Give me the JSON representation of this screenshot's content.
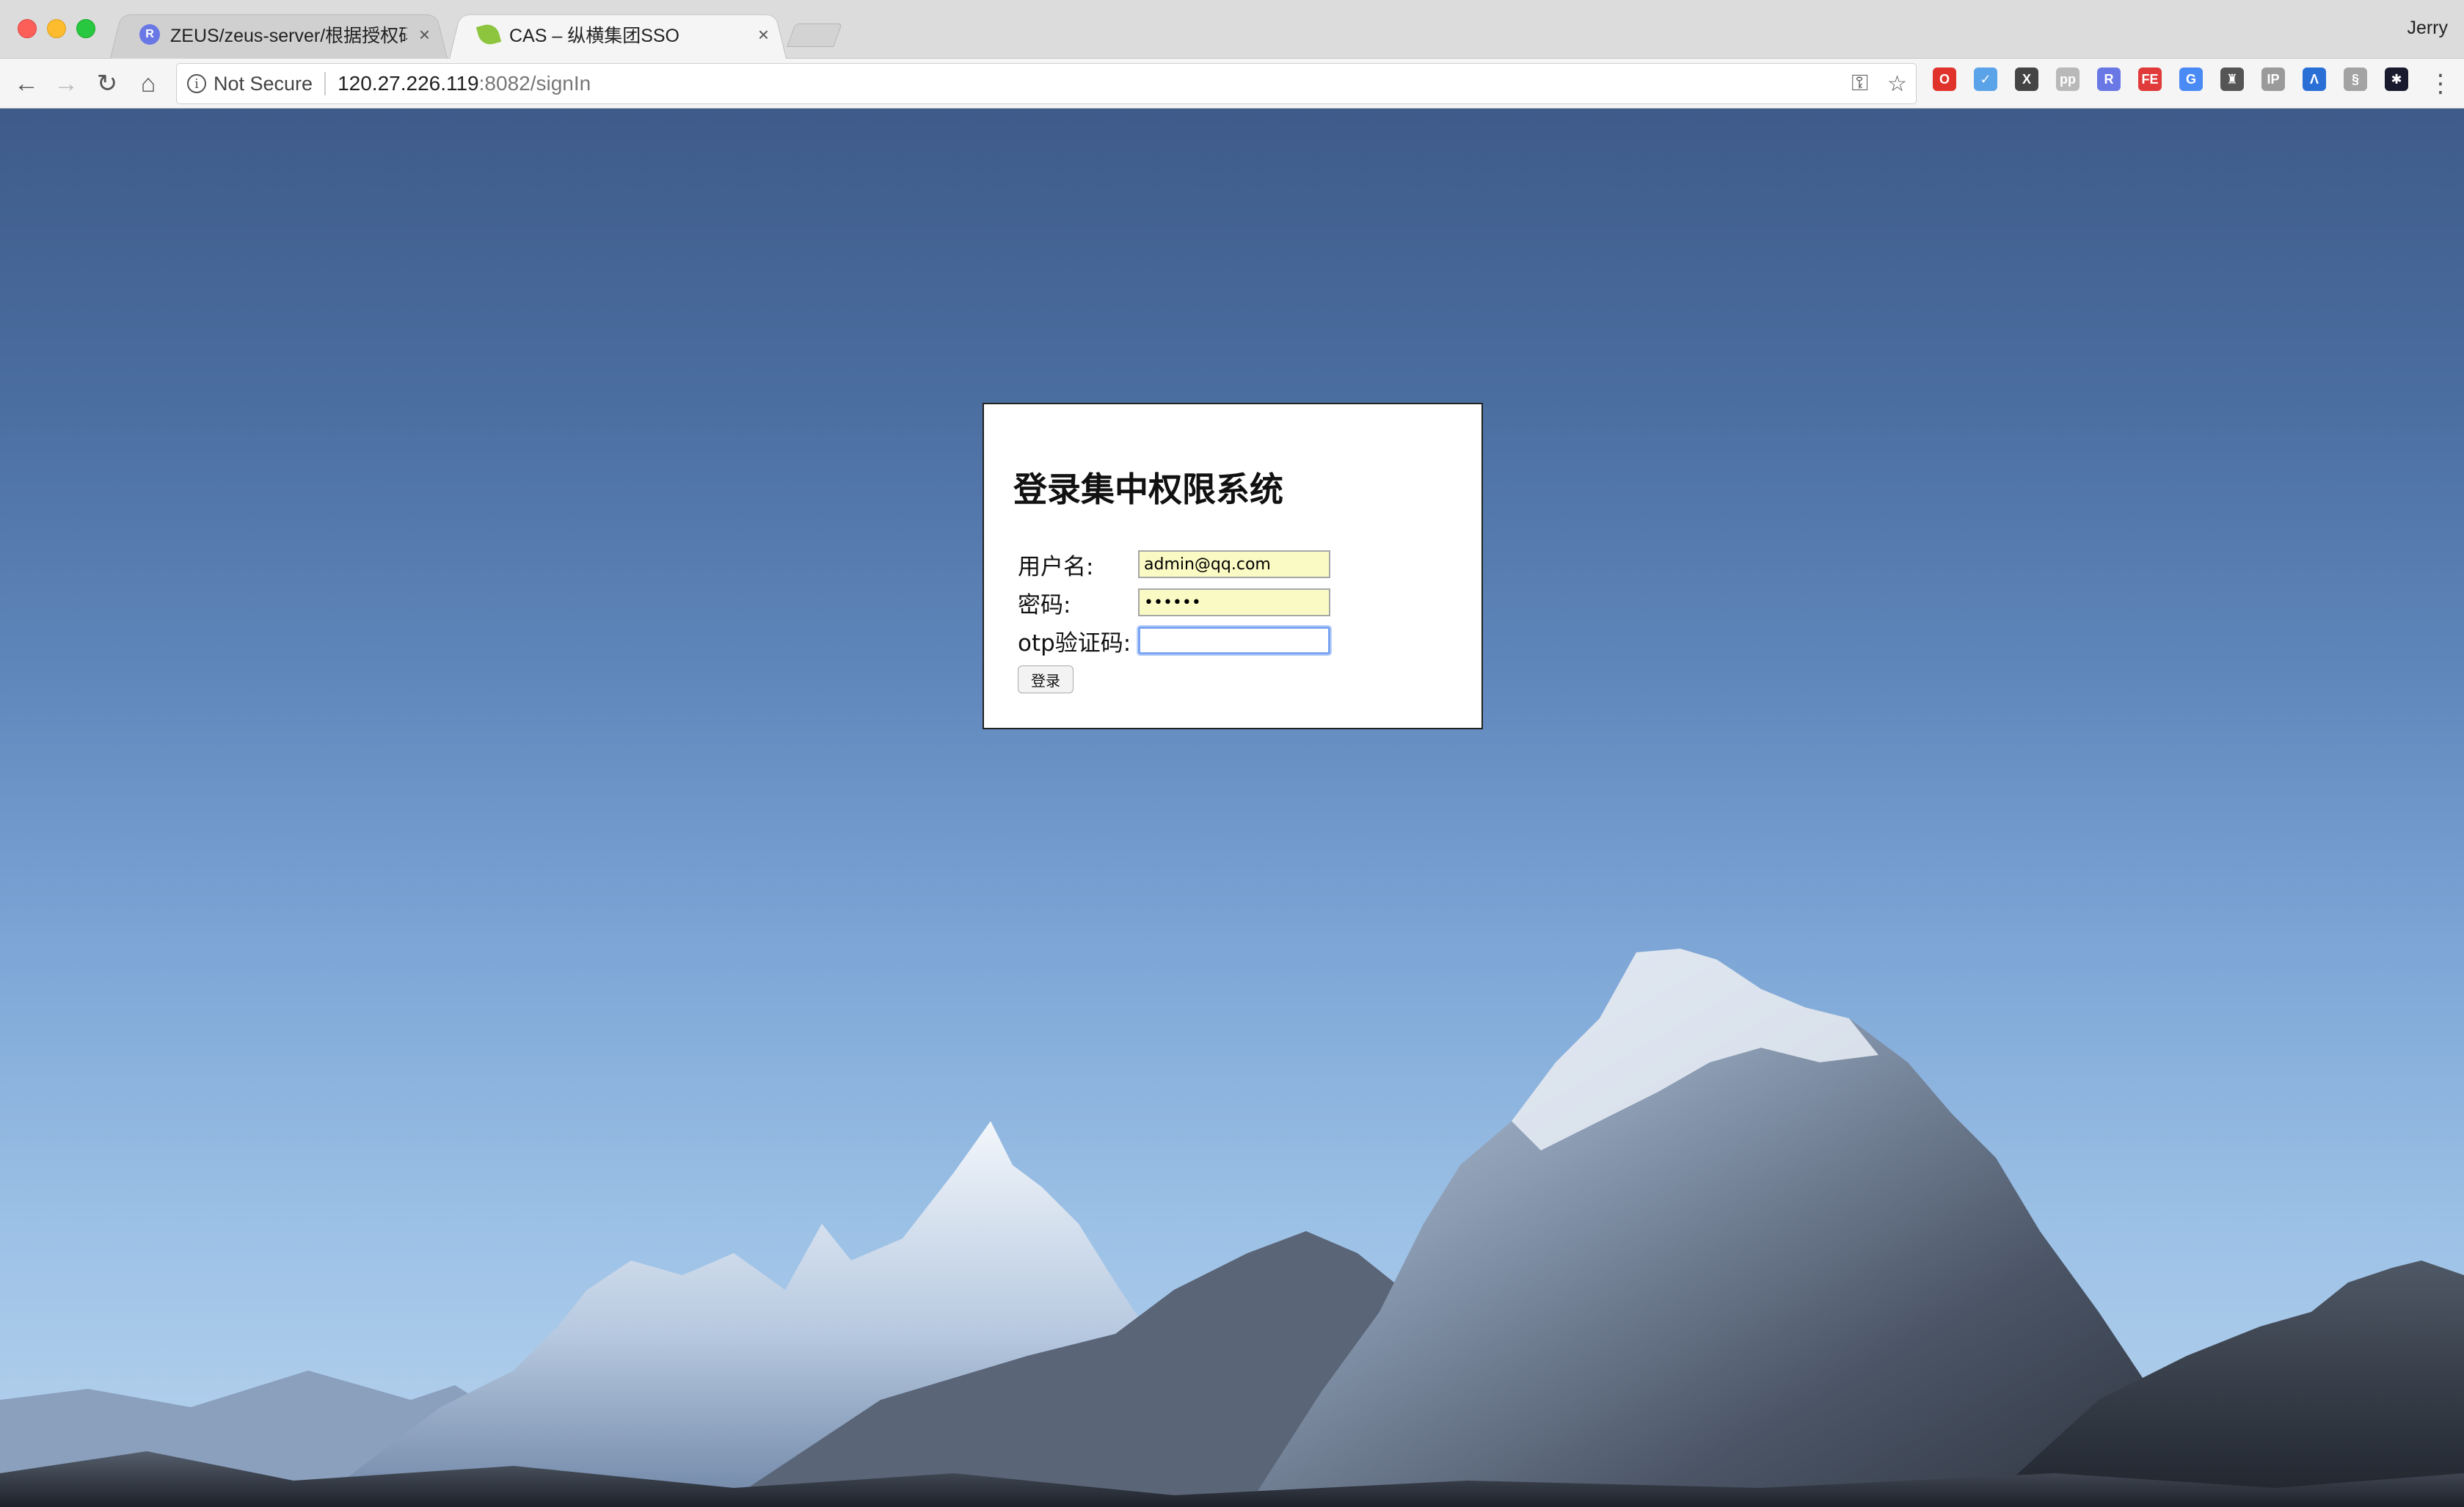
{
  "browser": {
    "tabs": [
      {
        "title": "ZEUS/zeus-server/根据授权码获",
        "close": "×",
        "favicon": "R"
      },
      {
        "title": "CAS – 纵横集团SSO",
        "close": "×"
      }
    ],
    "profile_name": "Jerry",
    "security_label": "Not Secure",
    "url_host": "120.27.226.119",
    "url_rest": ":8082/signIn",
    "nav": {
      "back": "←",
      "forward": "→",
      "reload": "↻",
      "home": "⌂"
    },
    "extensions": [
      {
        "name": "opera-icon",
        "label": "O",
        "color": "#e0332b"
      },
      {
        "name": "safari-icon",
        "label": "✓",
        "color": "#5ba3e8"
      },
      {
        "name": "x-ext-icon",
        "label": "X",
        "color": "#444444"
      },
      {
        "name": "notes-ext-icon",
        "label": "pp",
        "color": "#b9b9b9"
      },
      {
        "name": "r-ext-icon",
        "label": "R",
        "color": "#6a78e6"
      },
      {
        "name": "fe-ext-icon",
        "label": "FE",
        "color": "#e03a3a"
      },
      {
        "name": "translate-icon",
        "label": "G",
        "color": "#4a8af4"
      },
      {
        "name": "shield-ext-icon",
        "label": "♜",
        "color": "#555555"
      },
      {
        "name": "ip-ext-icon",
        "label": "IP",
        "color": "#9a9a9a"
      },
      {
        "name": "lambda-ext-icon",
        "label": "Λ",
        "color": "#2a6fd6"
      },
      {
        "name": "sign-ext-icon",
        "label": "§",
        "color": "#a3a3a3"
      },
      {
        "name": "star-ext-icon",
        "label": "✱",
        "color": "#1a1a2e"
      }
    ]
  },
  "login": {
    "title": "登录集中权限系统",
    "username_label": "用户名:",
    "username_value": "admin@qq.com",
    "password_label": "密码:",
    "password_value": "••••••",
    "otp_label": "otp验证码:",
    "otp_value": "",
    "submit_label": "登录"
  }
}
